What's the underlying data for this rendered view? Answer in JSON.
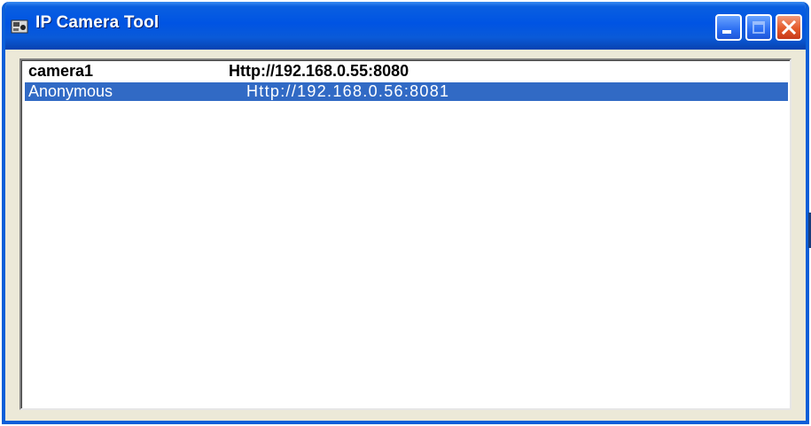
{
  "window": {
    "title": "IP Camera Tool",
    "icon": "camera-tool-icon"
  },
  "titlebar_buttons": {
    "minimize": "minimize-icon",
    "maximize": "maximize-icon",
    "close": "close-icon"
  },
  "colors": {
    "titlebar": "#0054e3",
    "selection": "#316ac5",
    "frame": "#0a5fd8",
    "close_button": "#e45a2a"
  },
  "camera_list": [
    {
      "name": "camera1",
      "url": "Http://192.168.0.55:8080",
      "selected": false
    },
    {
      "name": "Anonymous",
      "url": "Http://192.168.0.56:8081",
      "selected": true
    }
  ]
}
